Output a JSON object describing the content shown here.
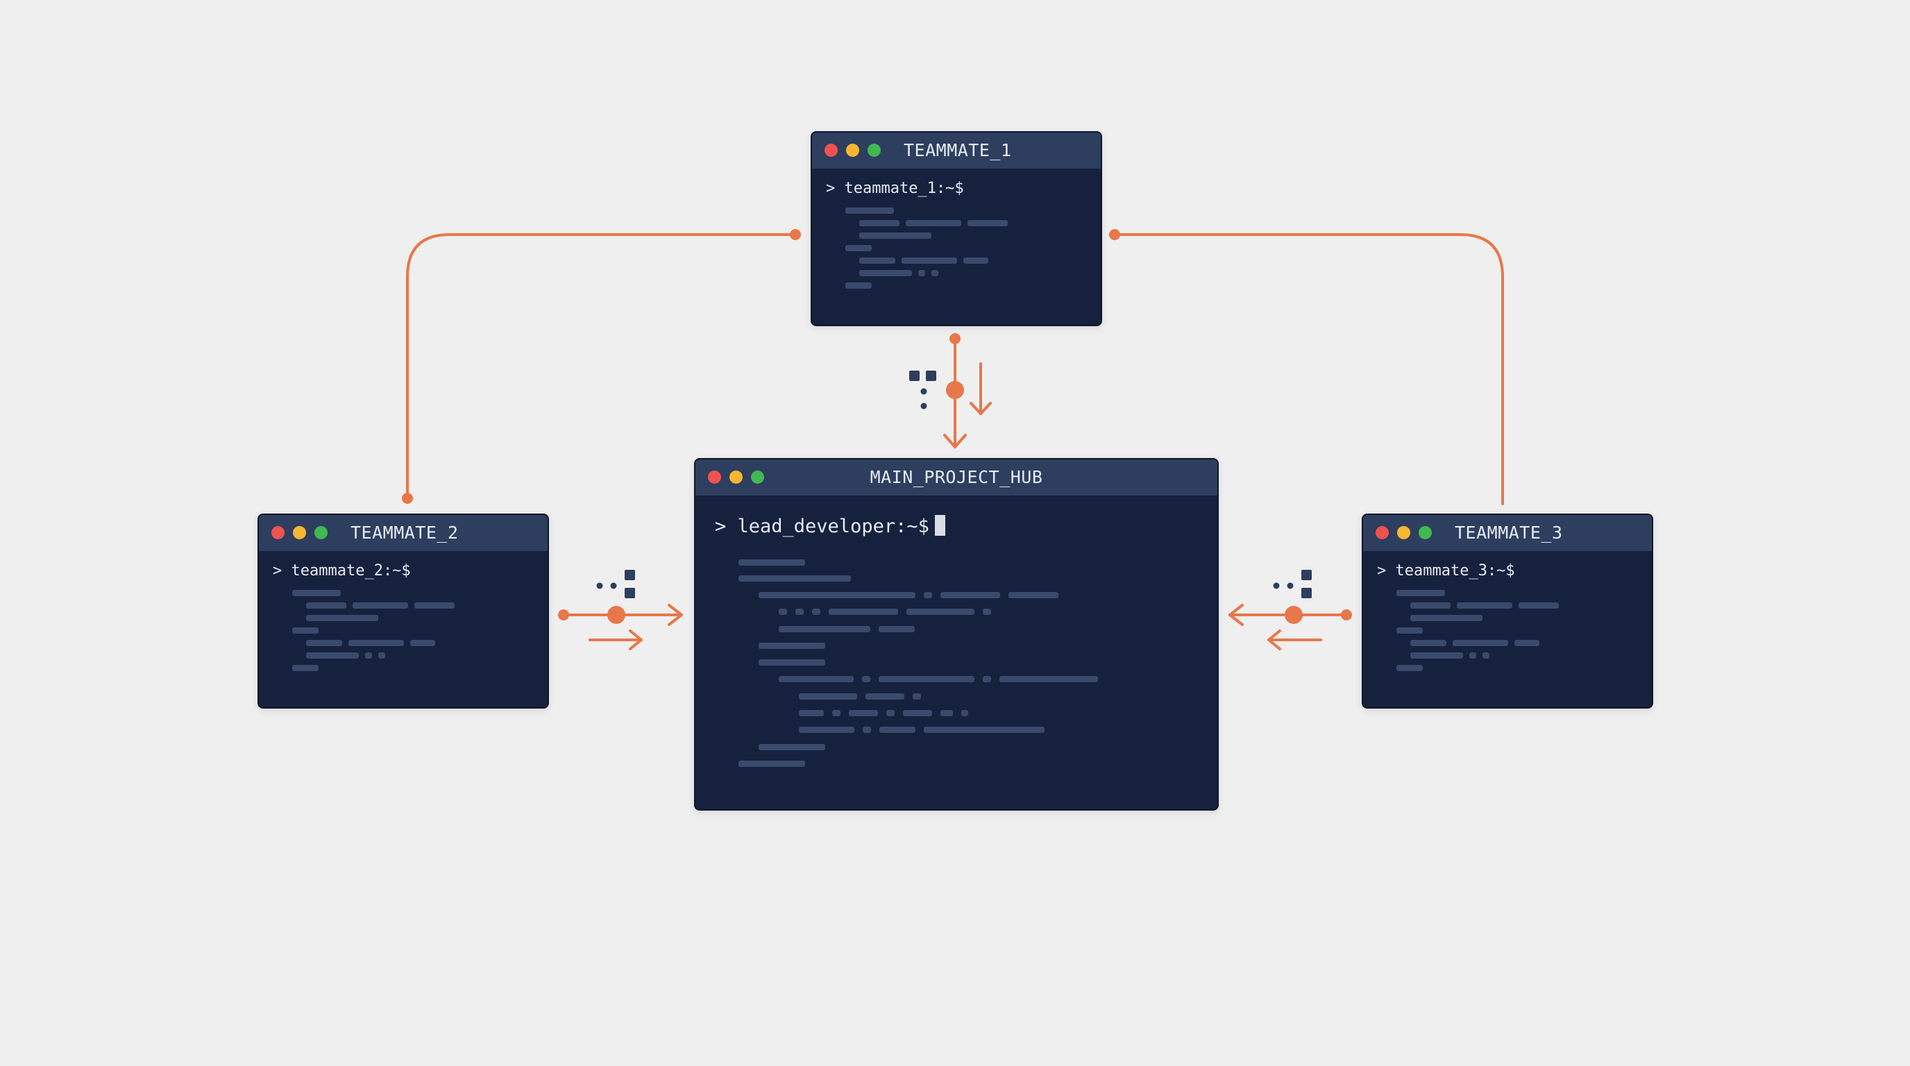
{
  "colors": {
    "background": "#efefef",
    "terminal_body": "#16213e",
    "terminal_titlebar": "#2e3e5f",
    "connector": "#e8774a",
    "code_placeholder": "#3a4a6c",
    "dot_red": "#ef5350",
    "dot_yellow": "#f7b733",
    "dot_green": "#3fb950"
  },
  "terminals": {
    "teammate_1": {
      "title": "TEAMMATE_1",
      "prompt": "> teammate_1:~$"
    },
    "teammate_2": {
      "title": "TEAMMATE_2",
      "prompt": "> teammate_2:~$"
    },
    "teammate_3": {
      "title": "TEAMMATE_3",
      "prompt": "> teammate_3:~$"
    },
    "hub": {
      "title": "MAIN_PROJECT_HUB",
      "prompt": "> lead_developer:~$"
    }
  },
  "icons": {
    "window_controls": [
      "close-dot-icon",
      "minimize-dot-icon",
      "maximize-dot-icon"
    ],
    "data_packet": "data-packet-icon",
    "cursor": "block-cursor-icon"
  },
  "connections": [
    {
      "from": "teammate_1",
      "to": "teammate_2",
      "style": "elbow line"
    },
    {
      "from": "teammate_1",
      "to": "teammate_3",
      "style": "elbow line"
    },
    {
      "from": "teammate_1",
      "to": "hub",
      "style": "arrow down"
    },
    {
      "from": "teammate_2",
      "to": "hub",
      "style": "arrow right"
    },
    {
      "from": "teammate_3",
      "to": "hub",
      "style": "arrow left"
    }
  ]
}
